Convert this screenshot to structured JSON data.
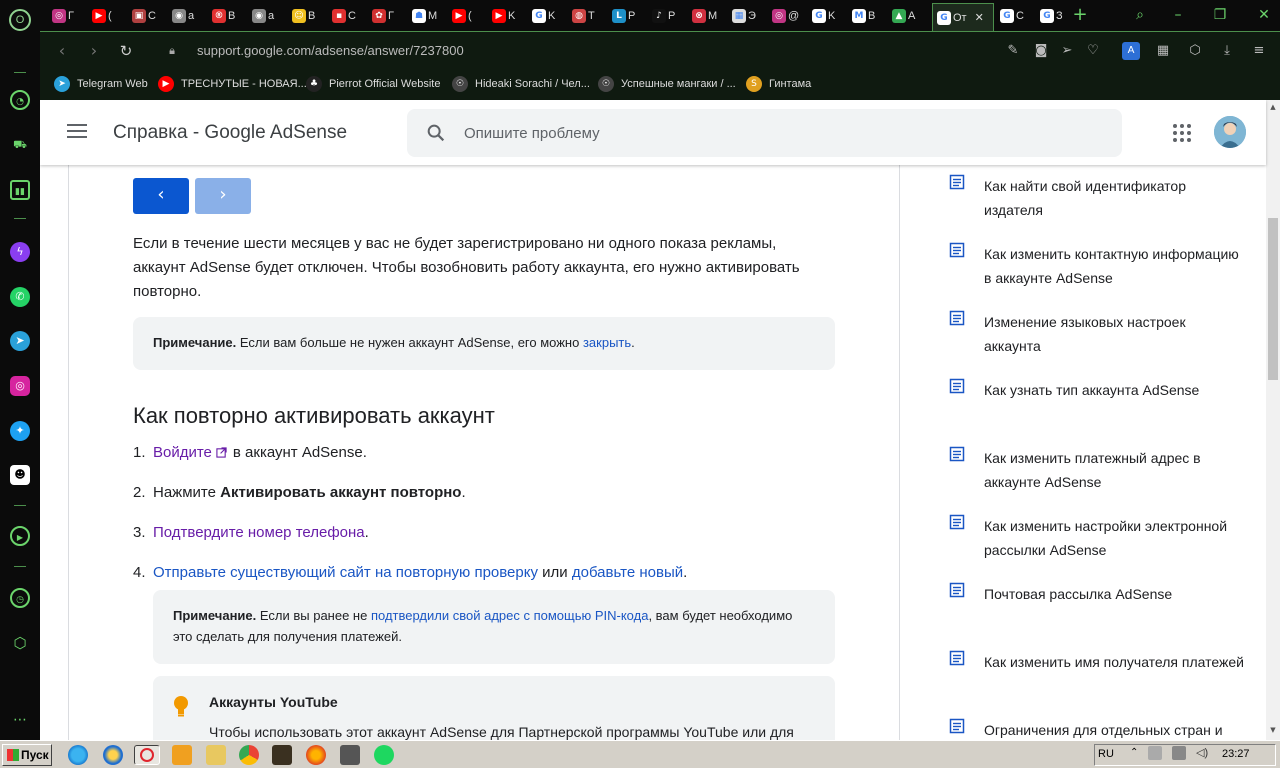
{
  "browser": {
    "tabs": [
      {
        "label": "Г",
        "color": "#c13584",
        "glyph": "◎"
      },
      {
        "label": "(",
        "color": "#ff0000",
        "glyph": "▶"
      },
      {
        "label": "C",
        "color": "#b04040",
        "glyph": "▣"
      },
      {
        "label": "a",
        "color": "#888888",
        "glyph": "◉"
      },
      {
        "label": "В",
        "color": "#e03030",
        "glyph": "®"
      },
      {
        "label": "a",
        "color": "#888888",
        "glyph": "◉"
      },
      {
        "label": "B",
        "color": "#f0c020",
        "glyph": "☺"
      },
      {
        "label": "С",
        "color": "#e03030",
        "glyph": "▪"
      },
      {
        "label": "Г",
        "color": "#d03030",
        "glyph": "✿"
      },
      {
        "label": "M",
        "color": "#ffffff",
        "glyph": "☗"
      },
      {
        "label": "(",
        "color": "#ff0000",
        "glyph": "▶"
      },
      {
        "label": "K",
        "color": "#ff0000",
        "glyph": "▶"
      },
      {
        "label": "K",
        "color": "#ffffff",
        "glyph": "G"
      },
      {
        "label": "Т",
        "color": "#cc4444",
        "glyph": "◍"
      },
      {
        "label": "Р",
        "color": "#1e90c8",
        "glyph": "L"
      },
      {
        "label": "Р",
        "color": "#111111",
        "glyph": "♪"
      },
      {
        "label": "M",
        "color": "#d03040",
        "glyph": "⊗"
      },
      {
        "label": "Э",
        "color": "#dddddd",
        "glyph": "▦"
      },
      {
        "label": "@",
        "color": "#c13584",
        "glyph": "◎"
      },
      {
        "label": "K",
        "color": "#ffffff",
        "glyph": "G"
      },
      {
        "label": "B",
        "color": "#ffffff",
        "glyph": "M"
      },
      {
        "label": "A",
        "color": "#34a853",
        "glyph": "▲"
      },
      {
        "label": "От",
        "color": "#ffffff",
        "glyph": "G"
      },
      {
        "label": "С",
        "color": "#ffffff",
        "glyph": "G"
      },
      {
        "label": "З",
        "color": "#ffffff",
        "glyph": "G"
      }
    ],
    "url": "support.google.com/adsense/answer/7237800",
    "bookmarks": [
      {
        "label": "Telegram Web",
        "color": "#2aa1da",
        "glyph": "➤"
      },
      {
        "label": "ТРЕСНУТЫЕ - НОВАЯ...",
        "color": "#ff0000",
        "glyph": "▶"
      },
      {
        "label": "Pierrot Official Website",
        "color": "#222222",
        "glyph": "♣"
      },
      {
        "label": "Hideaki Sorachi / Чел...",
        "color": "#444444",
        "glyph": "☉"
      },
      {
        "label": "Успешные мангаки / ...",
        "color": "#444444",
        "glyph": "☉"
      },
      {
        "label": "Гинтама",
        "color": "#e0a020",
        "glyph": "S"
      }
    ]
  },
  "header": {
    "title": "Справка - Google AdSense",
    "search_placeholder": "Опишите проблему"
  },
  "article": {
    "prev_label": "‹",
    "next_label": "›",
    "intro": "Если в течение шести месяцев у вас не будет зарегистрировано ни одного показа рекламы, аккаунт AdSense будет отключен. Чтобы возобновить работу аккаунта, его нужно активировать повторно.",
    "note1": {
      "bold": "Примечание.",
      "text": " Если вам больше не нужен аккаунт AdSense, его можно ",
      "link": "закрыть",
      "end": "."
    },
    "heading": "Как повторно активировать аккаунт",
    "step1": {
      "num": "1.",
      "link": "Войдите",
      "text": "в аккаунт AdSense."
    },
    "step2": {
      "num": "2.",
      "text": "Нажмите ",
      "bold": "Активировать аккаунт повторно",
      "end": "."
    },
    "step3": {
      "num": "3.",
      "link": "Подтвердите номер телефона",
      "end": "."
    },
    "step4": {
      "num": "4.",
      "link1": "Отправьте существующий сайт на повторную проверку",
      "mid": " или ",
      "link2": "добавьте новый",
      "end": "."
    },
    "note2": {
      "bold": "Примечание.",
      "text": " Если вы ранее не ",
      "link": "подтвердили свой адрес с помощью PIN-кода",
      "text2": ", вам будет необходимо это сделать для получения платежей."
    },
    "youtube": {
      "title": "Аккаунты YouTube",
      "text": "Чтобы использовать этот аккаунт AdSense для Партнерской программы YouTube или для"
    }
  },
  "related": [
    "Как найти свой идентификатор издателя",
    "Как изменить контактную информацию в аккаунте AdSense",
    "Изменение языковых настроек аккаунта",
    "Как узнать тип аккаунта AdSense",
    "Как изменить платежный адрес в аккаунте AdSense",
    "Как изменить настройки электронной рассылки AdSense",
    "Почтовая рассылка AdSense",
    "Как изменить имя получателя платежей",
    "Ограничения для отдельных стран и регионов в AdSense"
  ],
  "taskbar": {
    "start_label": "Пуск",
    "lang": "RU",
    "time": "23:27"
  },
  "colors": {
    "accent_blue": "#0b57d0",
    "visited_link": "#681da8",
    "link": "#1a56c4",
    "opera_green": "#6bd46b"
  }
}
